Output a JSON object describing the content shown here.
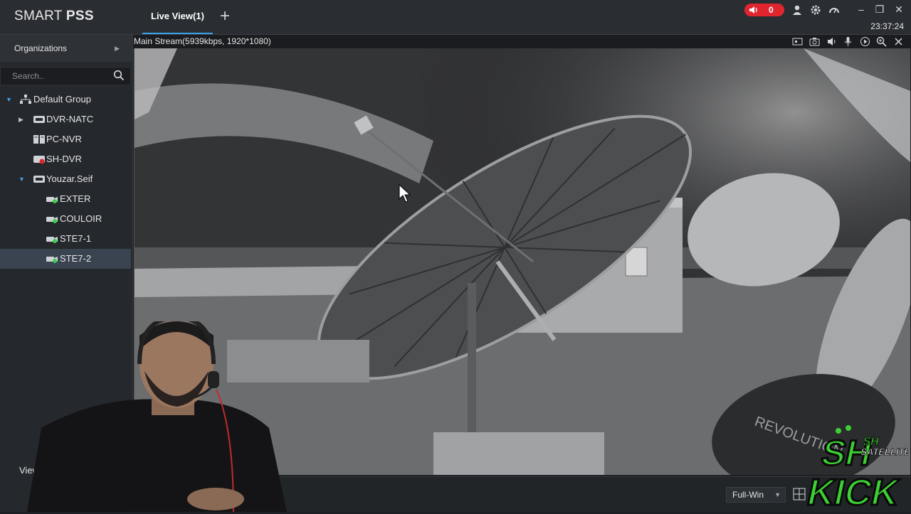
{
  "app": {
    "brand_light": "SMART ",
    "brand_bold": "PSS"
  },
  "tabs": [
    {
      "label": "Live View(1)"
    }
  ],
  "header": {
    "alarm_count": "0",
    "clock": "23:37:24"
  },
  "sidebar": {
    "org_label": "Organizations",
    "search_placeholder": "Search..",
    "tree": [
      {
        "label": "Default Group",
        "level": 0,
        "expanded": true,
        "icon": "group-icon"
      },
      {
        "label": "DVR-NATC",
        "level": 1,
        "expanded": false,
        "icon": "dvr-icon"
      },
      {
        "label": "PC-NVR",
        "level": 1,
        "icon": "nvr-icon"
      },
      {
        "label": "SH-DVR",
        "level": 1,
        "icon": "dvr-offline-icon"
      },
      {
        "label": "Youzar.Seif",
        "level": 1,
        "expanded": true,
        "icon": "dvr-icon"
      },
      {
        "label": "EXTER",
        "level": 2,
        "icon": "camera-icon"
      },
      {
        "label": "COULOIR",
        "level": 2,
        "icon": "camera-icon"
      },
      {
        "label": "STE7-1",
        "level": 2,
        "icon": "camera-icon"
      },
      {
        "label": "STE7-2",
        "level": 2,
        "icon": "camera-icon",
        "selected": true
      }
    ],
    "view_label": "View"
  },
  "video": {
    "stream_info": "Main Stream(5939kbps, 1920*1080)"
  },
  "footer": {
    "window_mode": "Full-Win"
  },
  "overlay": {
    "logo_line1": "SH",
    "logo_line2": "SATELLITE",
    "logo_line3": "KICK"
  },
  "colors": {
    "accent": "#3aa0e8",
    "alarm": "#e0252f",
    "online": "#3ccf4e",
    "logo_green": "#3bd132"
  }
}
